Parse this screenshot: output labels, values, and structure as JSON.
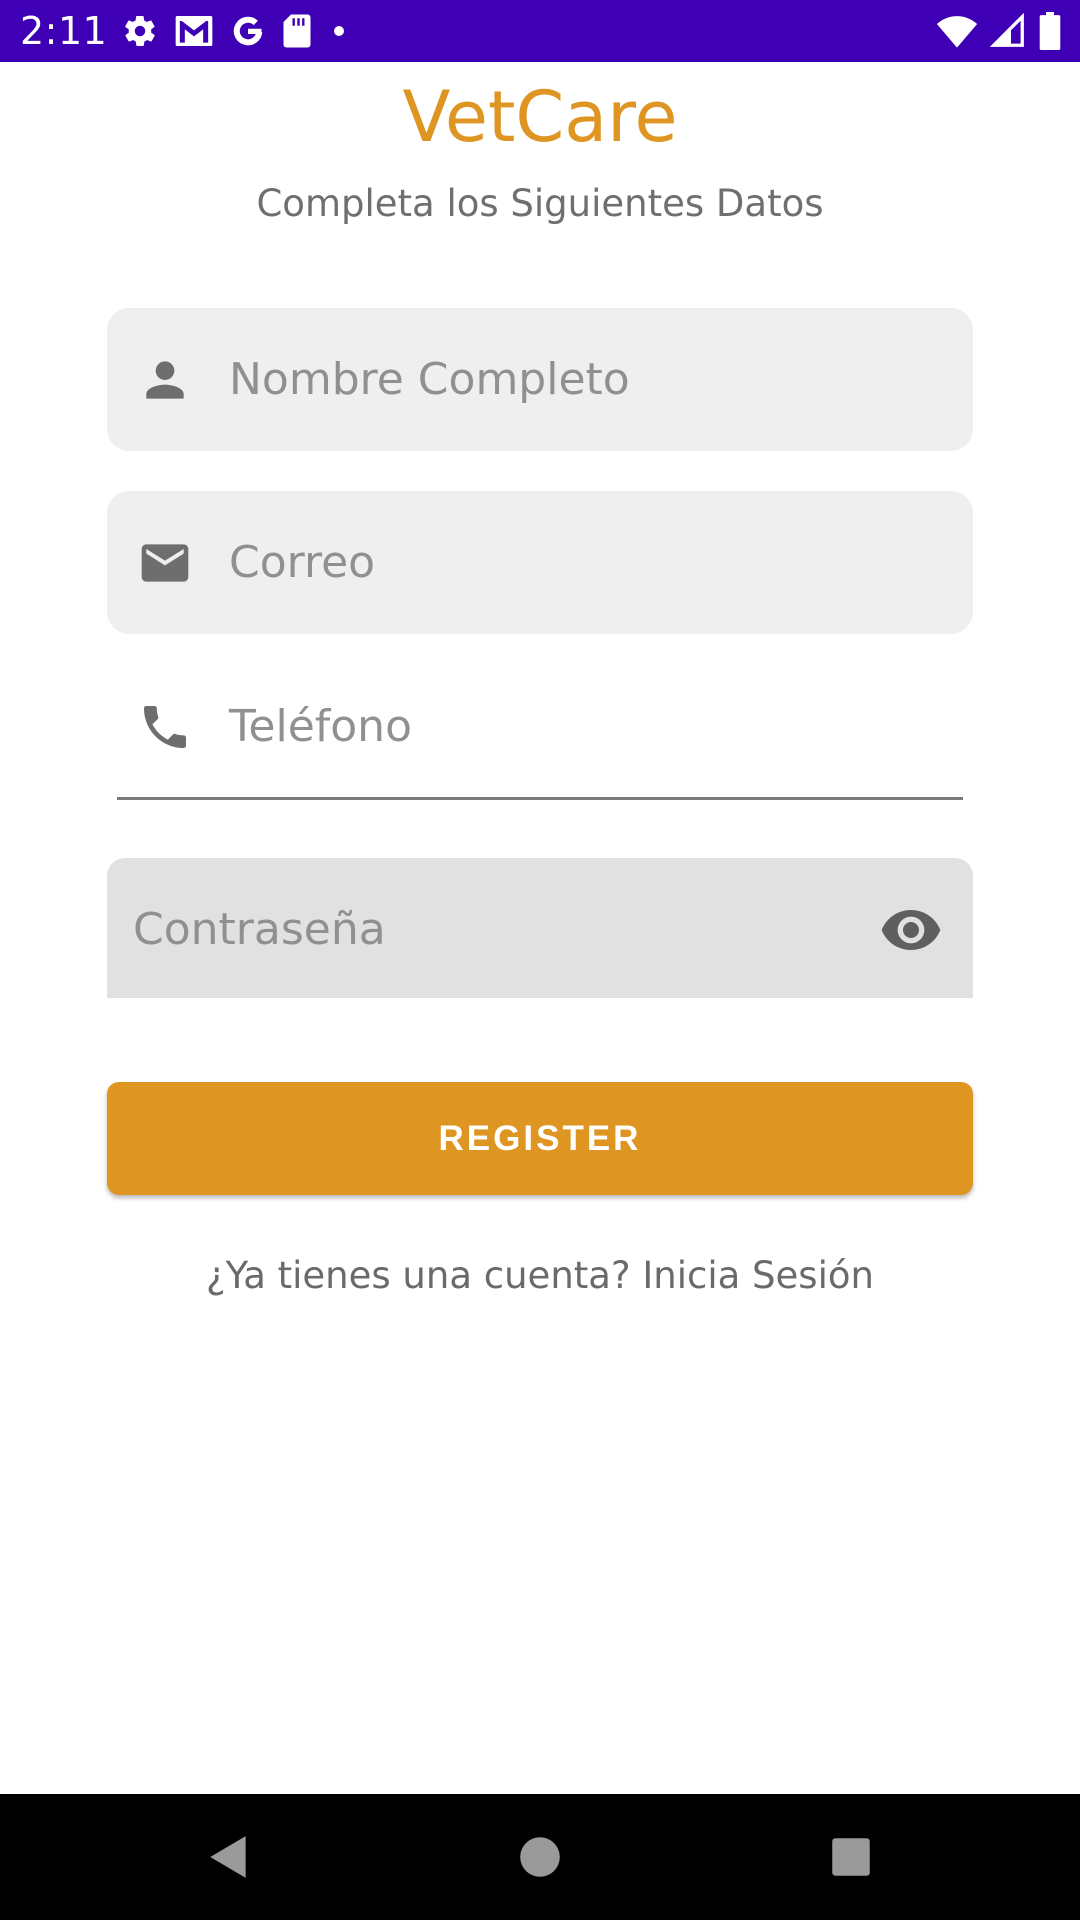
{
  "colors": {
    "status_bar": "#3F00B5",
    "accent": "#DF9522",
    "field_bg": "#EFEFEF",
    "password_bg": "#E1E1E1"
  },
  "status_bar": {
    "time": "2:11",
    "left_icons": [
      "gear-icon",
      "gmail-icon",
      "google-icon",
      "sd-card-icon",
      "dot-icon"
    ],
    "right_icons": [
      "wifi-icon",
      "signal-icon",
      "battery-icon"
    ]
  },
  "header": {
    "title": "VetCare",
    "subtitle": "Completa los Siguientes Datos"
  },
  "form": {
    "name": {
      "placeholder": "Nombre Completo",
      "icon": "person-icon"
    },
    "email": {
      "placeholder": "Correo",
      "icon": "mail-icon"
    },
    "phone": {
      "placeholder": "Teléfono",
      "icon": "phone-icon"
    },
    "password": {
      "placeholder": "Contraseña",
      "toggle_icon": "eye-icon"
    },
    "register_label": "REGISTER"
  },
  "footer": {
    "login_link": "¿Ya tienes una cuenta? Inicia Sesión"
  },
  "nav_bar": {
    "buttons": [
      "back-icon",
      "home-icon",
      "recents-icon"
    ]
  }
}
